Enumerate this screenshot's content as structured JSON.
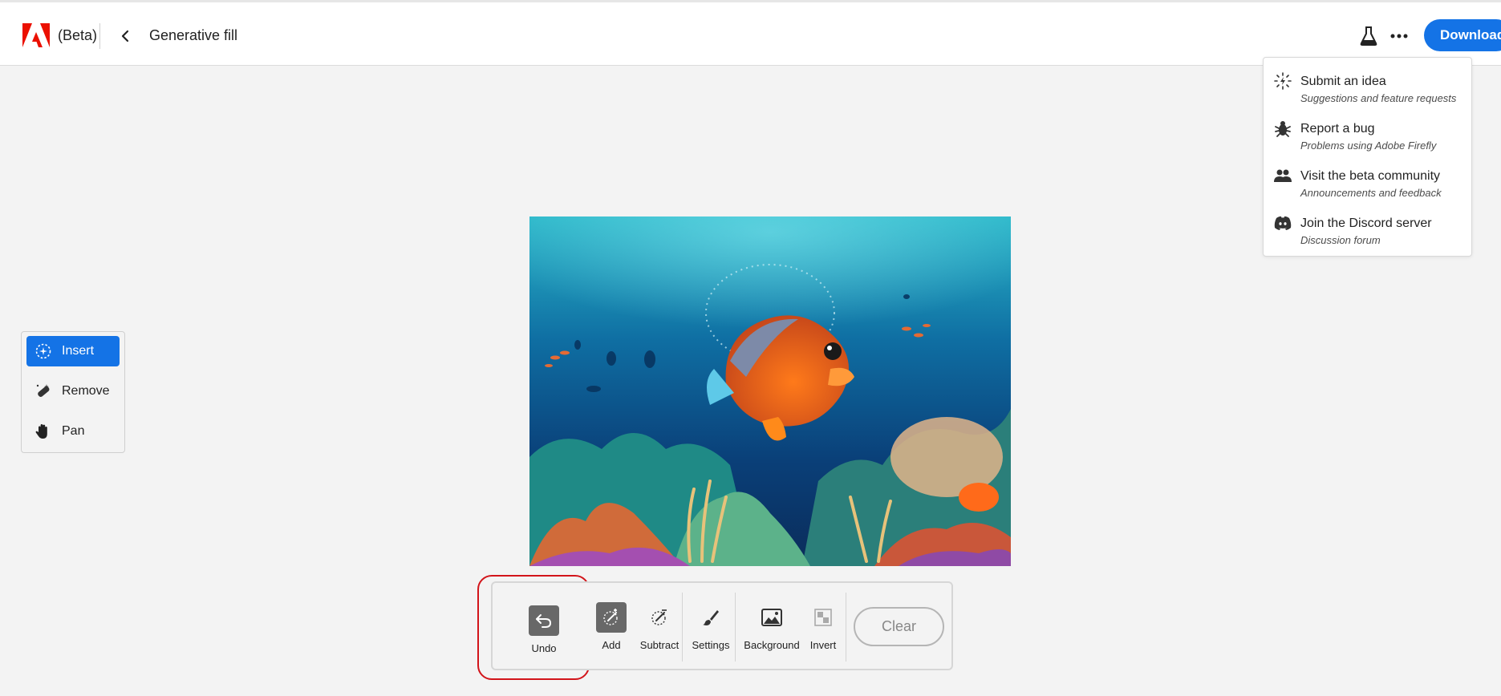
{
  "header": {
    "beta_label": "(Beta)",
    "title": "Generative fill",
    "download_label": "Download",
    "icons": {
      "logo": "adobe-logo",
      "back": "chevron-left-icon",
      "labs": "flask-icon",
      "more": "more-dots-icon"
    }
  },
  "menu": {
    "items": [
      {
        "label": "Submit an idea",
        "sub": "Suggestions and feature requests",
        "icon": "lightbulb-icon"
      },
      {
        "label": "Report a bug",
        "sub": "Problems using Adobe Firefly",
        "icon": "bug-icon"
      },
      {
        "label": "Visit the beta community",
        "sub": "Announcements and feedback",
        "icon": "community-icon"
      },
      {
        "label": "Join the Discord server",
        "sub": "Discussion forum",
        "icon": "discord-icon"
      }
    ]
  },
  "tools": {
    "items": [
      {
        "label": "Insert",
        "icon": "insert-icon",
        "active": true
      },
      {
        "label": "Remove",
        "icon": "remove-icon",
        "active": false
      },
      {
        "label": "Pan",
        "icon": "hand-icon",
        "active": false
      }
    ]
  },
  "canvas": {
    "image_description": "underwater coral reef with orange fish"
  },
  "bottom_bar": {
    "undo_label": "Undo",
    "add_label": "Add",
    "subtract_label": "Subtract",
    "settings_label": "Settings",
    "background_label": "Background",
    "invert_label": "Invert",
    "clear_label": "Clear"
  },
  "colors": {
    "accent": "#1473e6",
    "highlight": "#d2141a",
    "adobe_red": "#eb1000"
  }
}
